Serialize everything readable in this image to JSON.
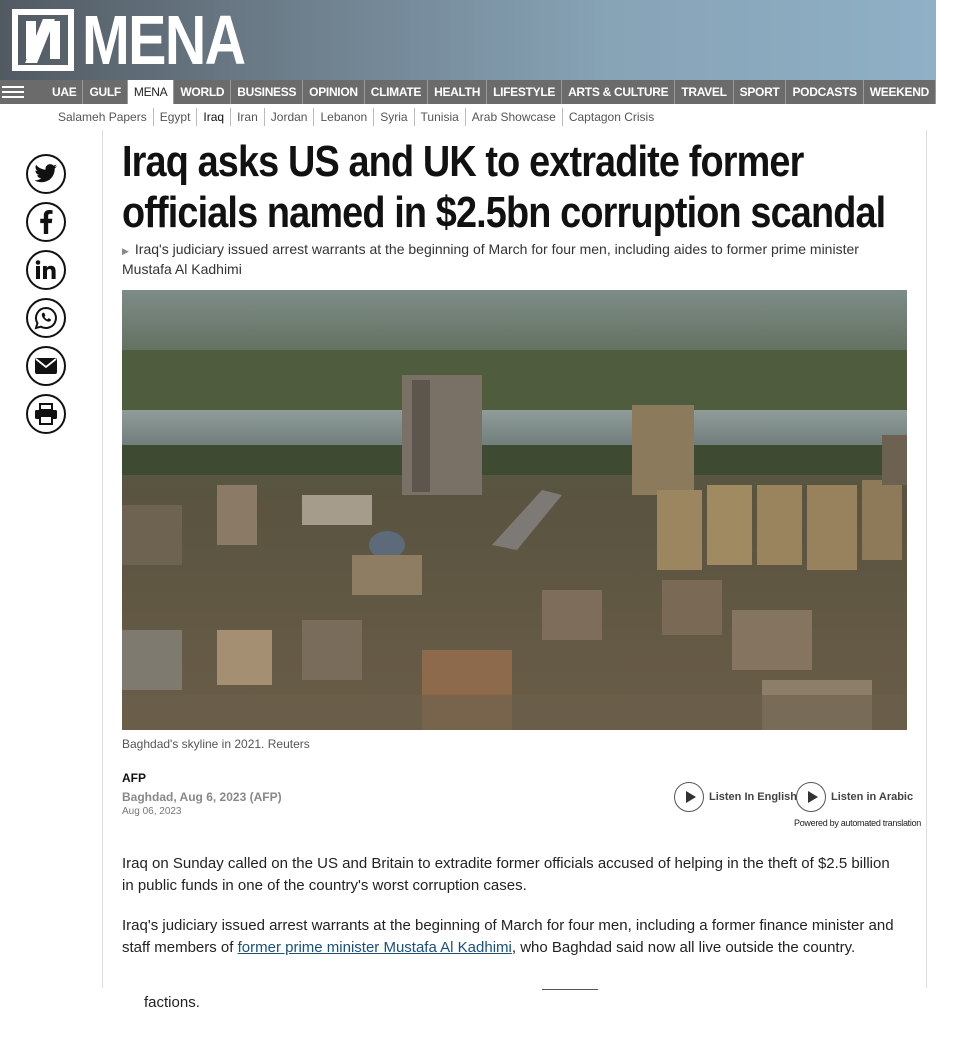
{
  "brand": {
    "logo_text": "MENA"
  },
  "nav": {
    "items": [
      "UAE",
      "GULF",
      "MENA",
      "WORLD",
      "BUSINESS",
      "OPINION",
      "CLIMATE",
      "HEALTH",
      "LIFESTYLE",
      "ARTS & CULTURE",
      "TRAVEL",
      "SPORT",
      "PODCASTS",
      "WEEKEND"
    ],
    "active": "MENA"
  },
  "subnav": {
    "items": [
      "Salameh Papers",
      "Egypt",
      "Iraq",
      "Iran",
      "Jordan",
      "Lebanon",
      "Syria",
      "Tunisia",
      "Arab Showcase",
      "Captagon Crisis"
    ],
    "active": "Iraq"
  },
  "share": [
    "twitter-icon",
    "facebook-icon",
    "linkedin-icon",
    "whatsapp-icon",
    "email-icon",
    "print-icon"
  ],
  "article": {
    "headline": "Iraq asks US and UK to extradite former officials named in $2.5bn corruption scandal",
    "standfirst": "Iraq's judiciary issued arrest warrants at the beginning of March for four men, including aides to former prime minister Mustafa Al Kadhimi",
    "caption": "Baghdad's skyline in 2021. Reuters",
    "author": "AFP",
    "dateline": "Baghdad, Aug 6, 2023 (AFP)",
    "date": "Aug 06, 2023",
    "listen_english": "Listen In English",
    "listen_arabic": "Listen in Arabic",
    "powered_by": "Powered by automated translation",
    "para1": "Iraq on Sunday called on the US and Britain to extradite former officials accused of helping in the theft of $2.5 billion in public funds in one of the country's worst corruption cases.",
    "para2_before": "Iraq's judiciary issued arrest warrants at the beginning of March for four men, including a former finance minister and staff members of ",
    "para2_link": "former prime minister Mustafa Al Kadhimi",
    "para2_after": ", who Baghdad said now all live outside the country.",
    "overflow_text": "factions."
  },
  "colors": {
    "nav_bg": "#6b6b6b",
    "link": "#1a4f7a"
  }
}
